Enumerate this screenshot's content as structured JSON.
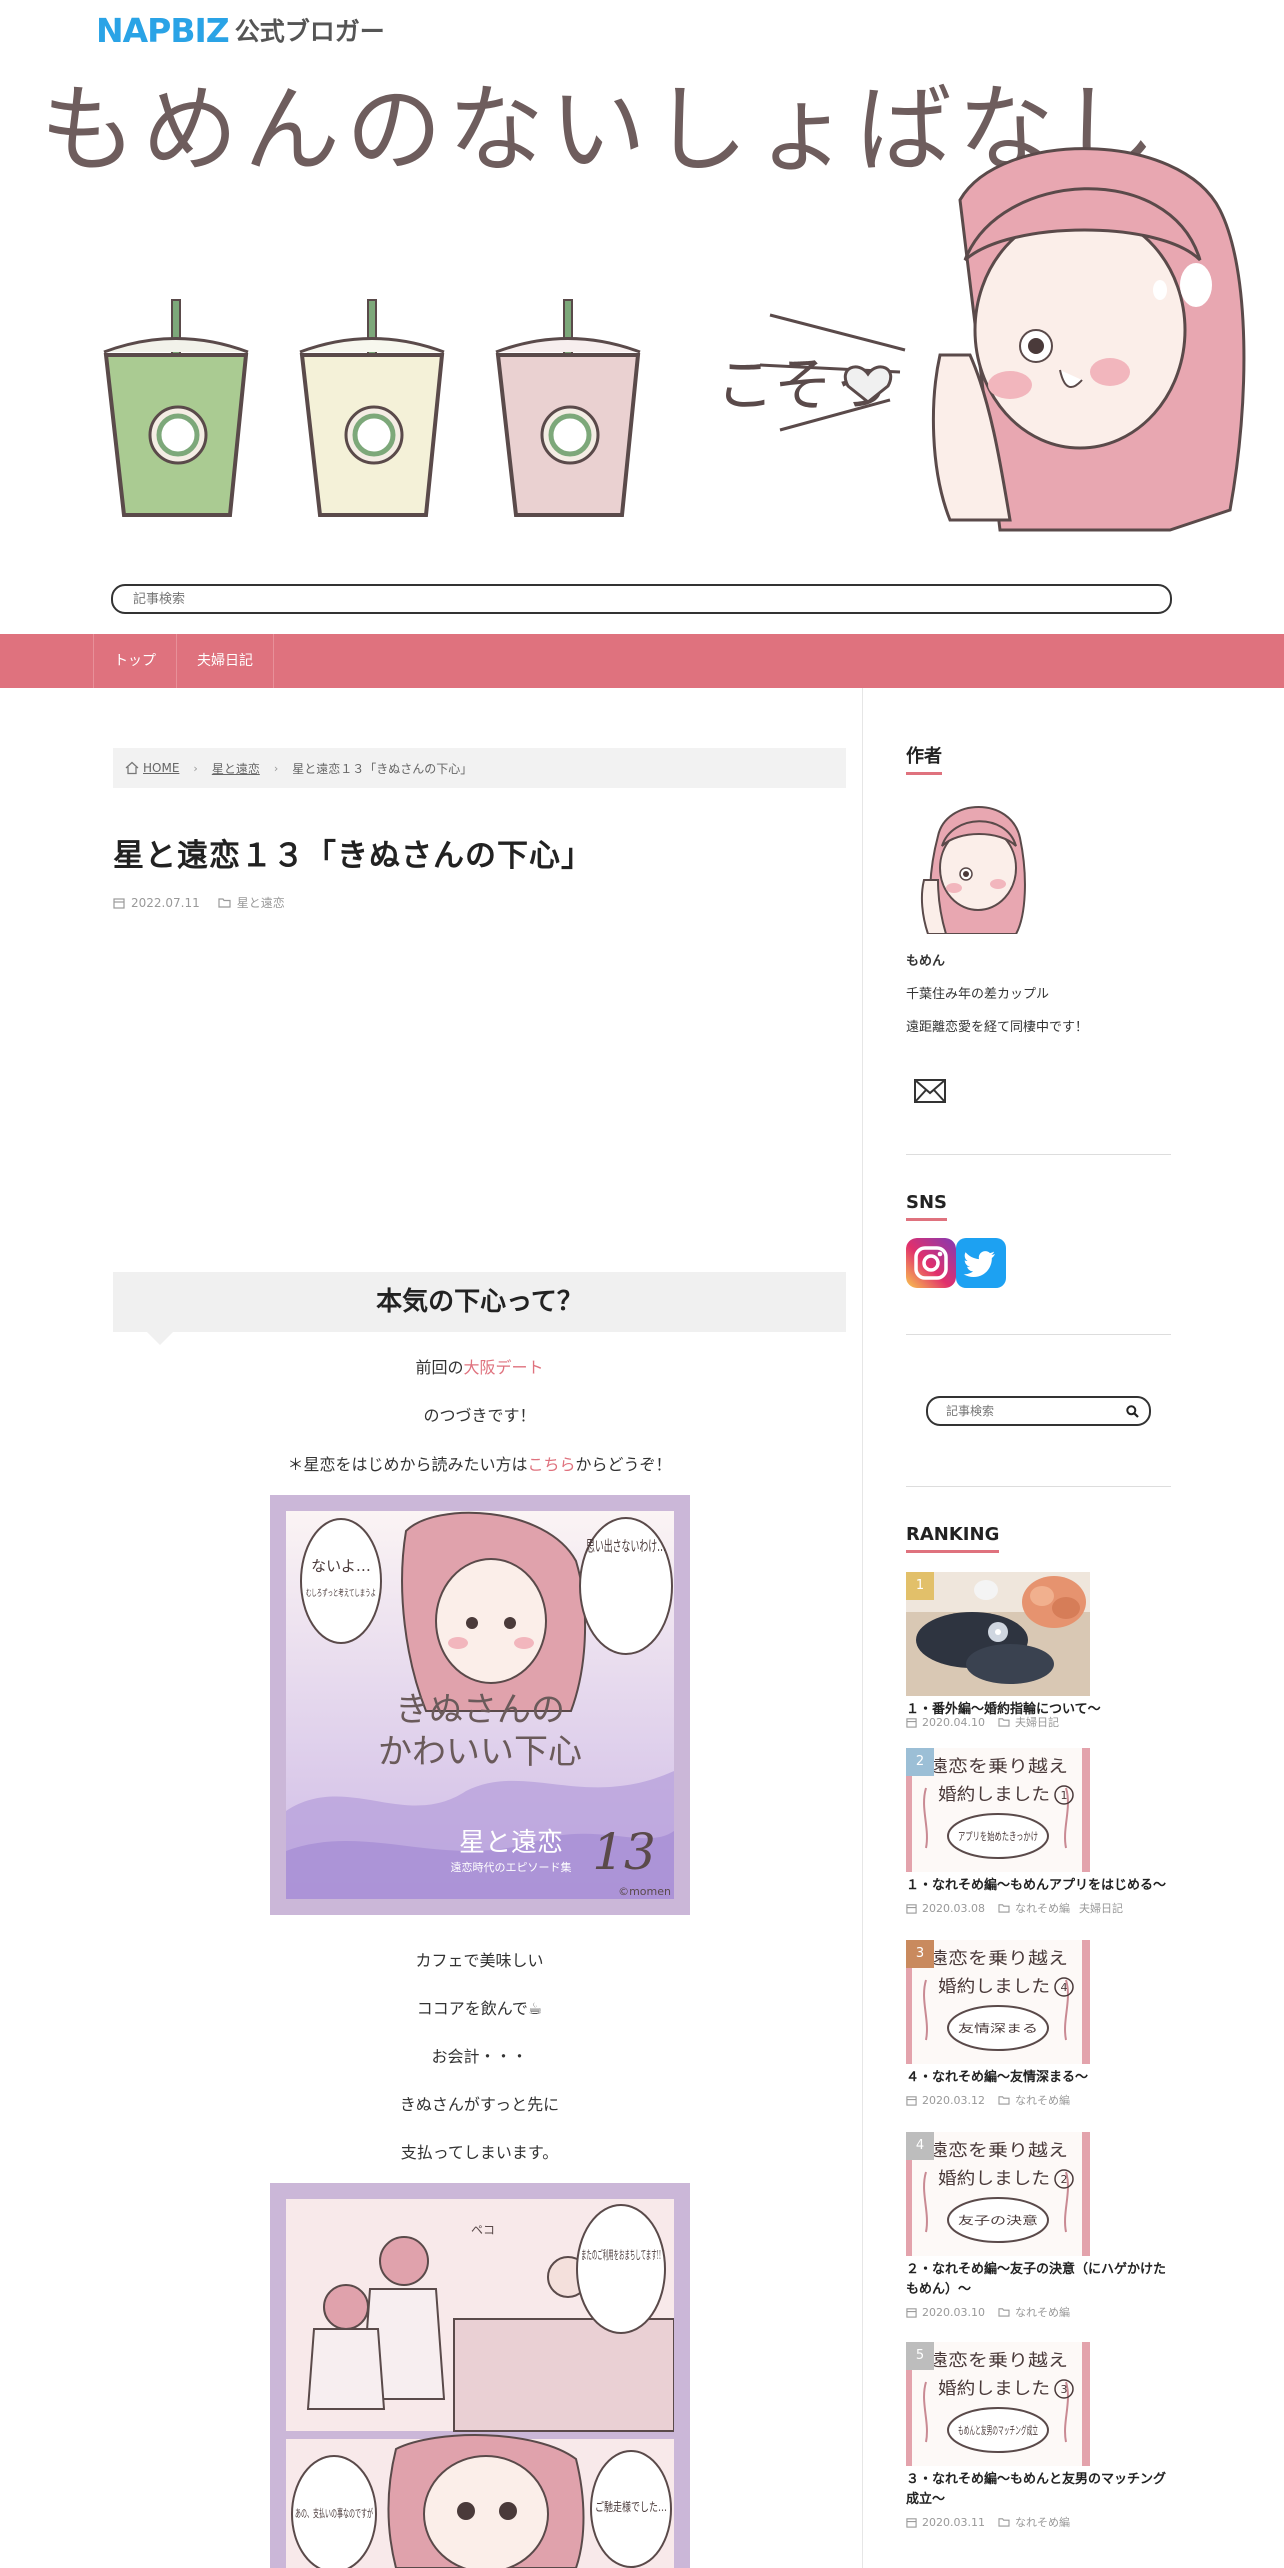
{
  "header": {
    "badge_brand": "NAPBIZ",
    "badge_label": "公式ブロガー",
    "site_title": "もめんのないしょばなし",
    "art_whisper_text": "こそっ",
    "search_placeholder": "記事検索"
  },
  "nav": {
    "items": [
      "トップ",
      "夫婦日記"
    ]
  },
  "breadcrumb": {
    "home": "HOME",
    "category": "星と遠恋",
    "current": "星と遠恋１３「きぬさんの下心」"
  },
  "post": {
    "title": "星と遠恋１３「きぬさんの下心」",
    "date": "2022.07.11",
    "category": "星と遠恋",
    "heading": "本気の下心って？",
    "line1_a": "前回の",
    "line1_link": "大阪デート",
    "line2": "のつづきです！",
    "line3_a": "＊星恋をはじめから読みたい方は",
    "line3_link": "こちら",
    "line3_b": "からどうぞ！",
    "comic1": {
      "bubble_right": "思い出さないわけ…",
      "bubble_left": "ないよ…",
      "bubble_left_small": "むしろずっと考えてしまうよ",
      "title_line1": "きぬさんの",
      "title_line2": "かわいい下心",
      "series": "星と遠恋",
      "series_sub": "遠恋時代のエピソード集",
      "number": "13",
      "credit": "©momen"
    },
    "line4": "カフェで美味しい",
    "line5": "ココアを飲んで☕",
    "line6": "お会計・・・",
    "line7": "きぬさんがすっと先に",
    "line8": "支払ってしまいます。",
    "comic2": {
      "bubble_right": "またのご利用をおまちしてます!!",
      "sfx": "ペコ",
      "bubble_bottom_right": "ご馳走様でした…",
      "bubble_bottom_left": "あの、支払いの事なのですが"
    }
  },
  "sidebar": {
    "author_heading": "作者",
    "author_name": "もめん",
    "author_line1": "千葉住み年の差カップル",
    "author_line2": "遠距離恋愛を経て同棲中です！",
    "sns_heading": "SNS",
    "search_placeholder": "記事検索",
    "ranking_heading": "RANKING",
    "ranking": [
      {
        "num": "1",
        "title": "１・番外編～婚約指輪について～",
        "date": "2020.04.10",
        "category": "夫婦日記",
        "category2": "",
        "num_color": "#e2c06a"
      },
      {
        "num": "2",
        "title": "１・なれそめ編～もめんアプリをはじめる～",
        "date": "2020.03.08",
        "category": "なれそめ編",
        "category2": "夫婦日記",
        "num_color": "#9cbfd6",
        "thumb_note": "アプリを始めたきっかけ",
        "thumb_circle": "1"
      },
      {
        "num": "3",
        "title": "４・なれそめ編～友情深まる～",
        "date": "2020.03.12",
        "category": "なれそめ編",
        "category2": "",
        "num_color": "#c98a5e",
        "thumb_note": "友情深まる",
        "thumb_circle": "4"
      },
      {
        "num": "4",
        "title": "２・なれそめ編～友子の決意（にハゲかけたもめん）～",
        "date": "2020.03.10",
        "category": "なれそめ編",
        "category2": "",
        "num_color": "#bdbdbd",
        "thumb_note": "友子の決意",
        "thumb_circle": "2"
      },
      {
        "num": "5",
        "title": "３・なれそめ編～もめんと友男のマッチング成立～",
        "date": "2020.03.11",
        "category": "なれそめ編",
        "category2": "",
        "num_color": "#bdbdbd",
        "thumb_note": "もめんと友男のマッチング成立",
        "thumb_circle": "3"
      }
    ],
    "thumb_banner_line1": "遠恋を乗り越え",
    "thumb_banner_line2": "婚約しました"
  },
  "colors": {
    "accent": "#df727e",
    "comic_frame": "#cbb7d8",
    "breadcrumb_bg": "#f2f2f2"
  }
}
